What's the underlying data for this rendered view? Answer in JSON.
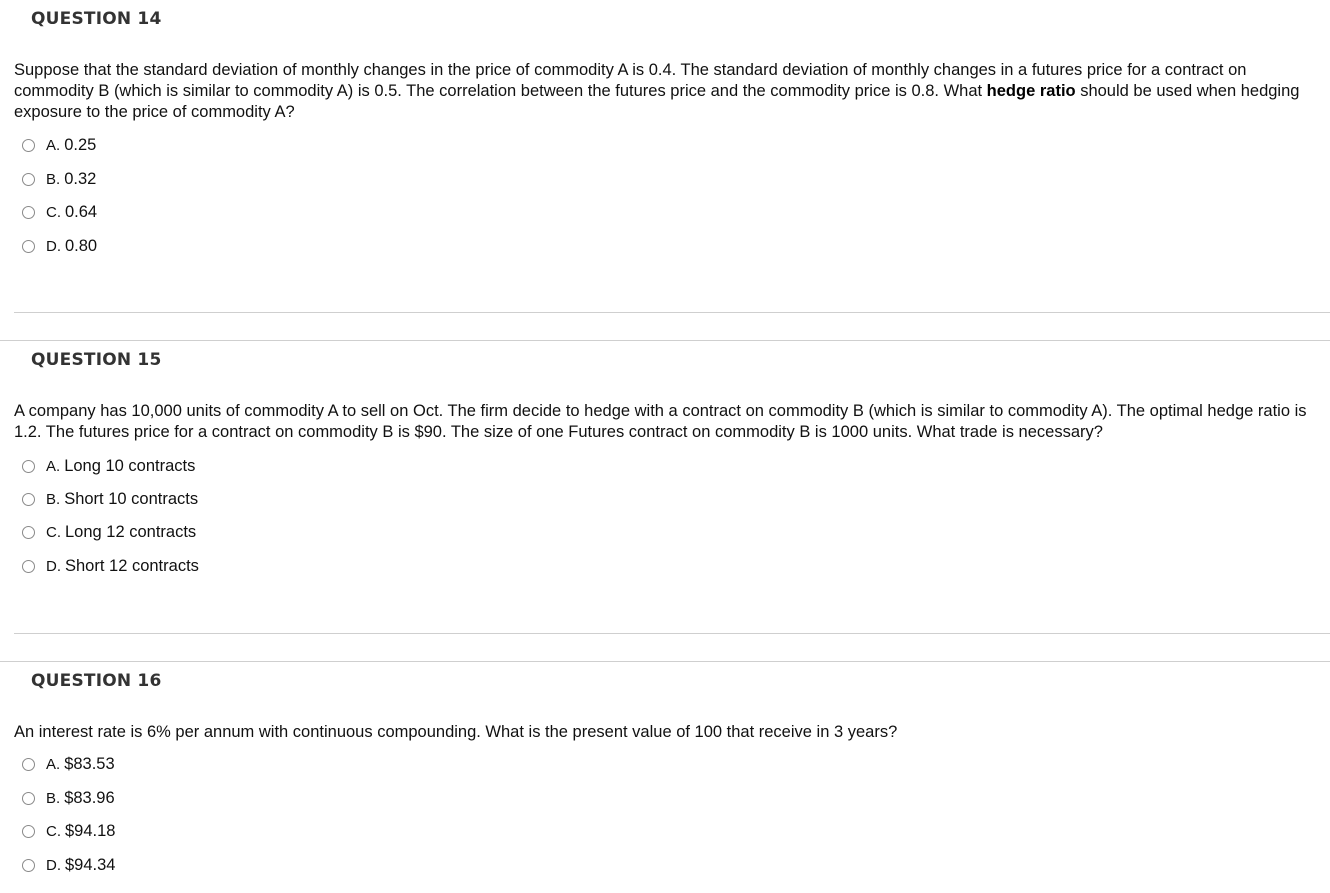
{
  "questions": [
    {
      "title": "QUESTION 14",
      "text_before_bold": "Suppose that the standard deviation of monthly changes in the price of commodity A is 0.4. The standard deviation of monthly changes in a futures price for a contract on commodity B (which is similar to commodity A) is 0.5. The correlation between the futures price and the commodity price is 0.8. What ",
      "text_bold": "hedge ratio",
      "text_after_bold": " should be used when hedging exposure to the price of commodity A?",
      "options": [
        {
          "letter": "A.",
          "text": "0.25"
        },
        {
          "letter": "B.",
          "text": "0.32"
        },
        {
          "letter": "C.",
          "text": "0.64"
        },
        {
          "letter": "D.",
          "text": "0.80"
        }
      ]
    },
    {
      "title": "QUESTION 15",
      "text_before_bold": "A company has 10,000 units of commodity A to sell on Oct. The firm decide to hedge with a contract on commodity B (which is similar to commodity A). The optimal hedge ratio is 1.2. The futures price for a contract on commodity B is $90. The size of one Futures contract on commodity B is 1000 units. What trade is necessary?",
      "text_bold": "",
      "text_after_bold": "",
      "options": [
        {
          "letter": "A.",
          "text": "Long 10 contracts"
        },
        {
          "letter": "B.",
          "text": "Short 10 contracts"
        },
        {
          "letter": "C.",
          "text": "Long 12 contracts"
        },
        {
          "letter": "D.",
          "text": "Short 12 contracts"
        }
      ]
    },
    {
      "title": "QUESTION 16",
      "text_before_bold": "An interest rate is 6% per annum with continuous compounding. What is the present value of 100 that receive in 3 years?",
      "text_bold": "",
      "text_after_bold": "",
      "options": [
        {
          "letter": "A.",
          "text": "$83.53"
        },
        {
          "letter": "B.",
          "text": "$83.96"
        },
        {
          "letter": "C.",
          "text": "$94.18"
        },
        {
          "letter": "D.",
          "text": "$94.34"
        }
      ]
    }
  ]
}
